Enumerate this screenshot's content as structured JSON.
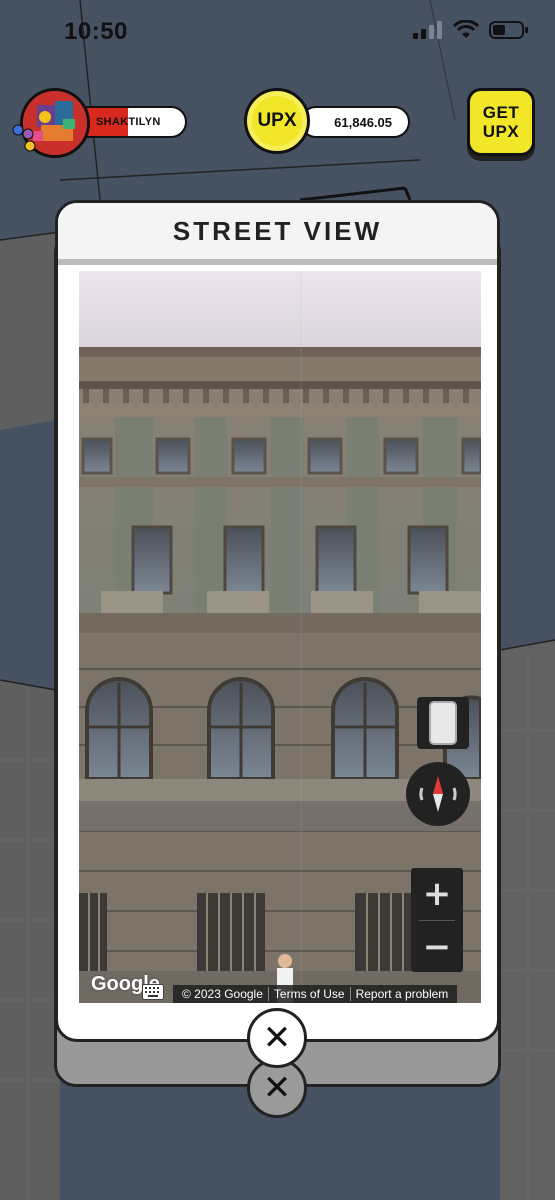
{
  "status_bar": {
    "time": "10:50"
  },
  "player": {
    "name": "SHAKTILYN"
  },
  "currency": {
    "coin_label": "UPX",
    "balance": "61,846.05"
  },
  "get_upx": {
    "line1": "GET",
    "line2": "UPX"
  },
  "modal": {
    "title": "STREET VIEW"
  },
  "street_view": {
    "logo": "Google",
    "copyright": "© 2023 Google",
    "terms": "Terms of Use",
    "report": "Report a problem",
    "zoom_in": "+",
    "zoom_out": "−"
  },
  "close_buttons": {
    "symbol": "✕"
  },
  "colors": {
    "accent_yellow": "#f2e629",
    "player_red": "#d9281e",
    "map_blue": "#465261"
  }
}
